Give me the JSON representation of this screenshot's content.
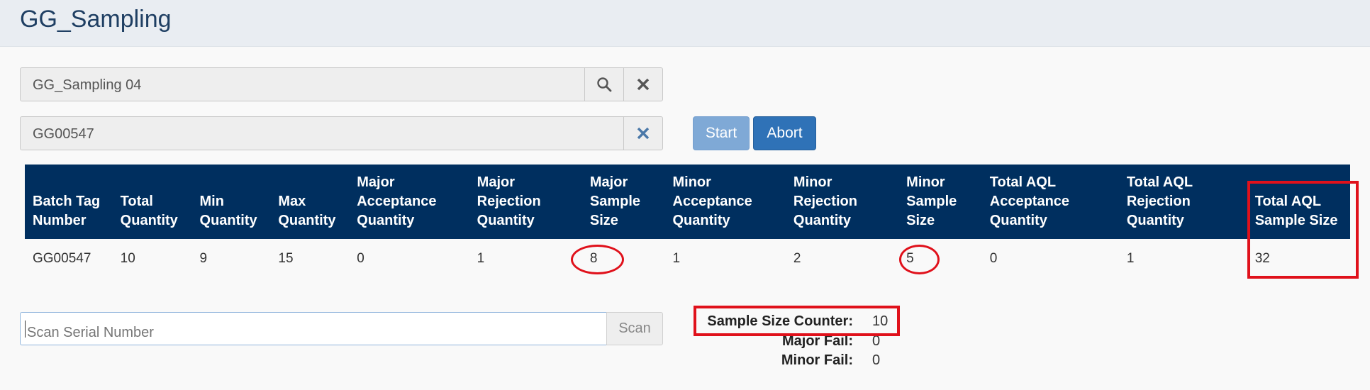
{
  "header": {
    "title": "GG_Sampling"
  },
  "sampling_plan": {
    "value": "GG_Sampling 04"
  },
  "batch": {
    "value": "GG00547"
  },
  "buttons": {
    "start": "Start",
    "abort": "Abort",
    "scan": "Scan"
  },
  "table": {
    "headers": [
      [
        "Batch Tag",
        "Number"
      ],
      [
        "Total",
        "Quantity"
      ],
      [
        "Min",
        "Quantity"
      ],
      [
        "Max",
        "Quantity"
      ],
      [
        "Major",
        "Acceptance",
        "Quantity"
      ],
      [
        "Major",
        "Rejection",
        "Quantity"
      ],
      [
        "Major",
        "Sample",
        "Size"
      ],
      [
        "Minor",
        "Acceptance",
        "Quantity"
      ],
      [
        "Minor",
        "Rejection",
        "Quantity"
      ],
      [
        "Minor",
        "Sample",
        "Size"
      ],
      [
        "Total AQL",
        "Acceptance",
        "Quantity"
      ],
      [
        "Total AQL",
        "Rejection",
        "Quantity"
      ],
      [
        "Total AQL",
        "Sample Size"
      ]
    ],
    "row": [
      "GG00547",
      "10",
      "9",
      "15",
      "0",
      "1",
      "8",
      "1",
      "2",
      "5",
      "0",
      "1",
      "32"
    ]
  },
  "scan": {
    "placeholder": "Scan Serial Number"
  },
  "stats": {
    "sample_size_counter_label": "Sample Size Counter:",
    "sample_size_counter_value": "10",
    "major_fail_label": "Major Fail:",
    "major_fail_value": "0",
    "minor_fail_label": "Minor Fail:",
    "minor_fail_value": "0"
  },
  "icons": {
    "search": "search-icon",
    "clear": "close-icon"
  },
  "colors": {
    "header_bg": "#002f5f",
    "annotation": "#e0111b",
    "abort": "#2f72b7",
    "start": "#7fa9d6"
  }
}
